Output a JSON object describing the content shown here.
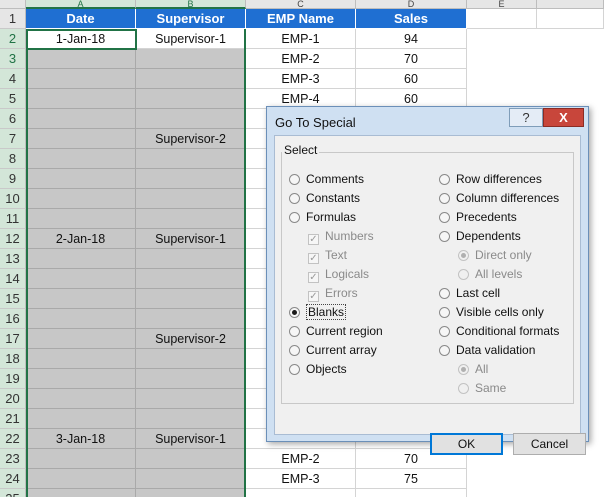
{
  "sheet": {
    "columns": [
      "A",
      "B",
      "C",
      "D",
      "E"
    ],
    "headers": [
      "Date",
      "Supervisor",
      "EMP Name",
      "Sales"
    ],
    "rows": [
      {
        "n": "2",
        "date": "1-Jan-18",
        "sup": "Supervisor-1",
        "emp": "EMP-1",
        "sales": "94"
      },
      {
        "n": "3",
        "date": "",
        "sup": "",
        "emp": "EMP-2",
        "sales": "70"
      },
      {
        "n": "4",
        "date": "",
        "sup": "",
        "emp": "EMP-3",
        "sales": "60"
      },
      {
        "n": "5",
        "date": "",
        "sup": "",
        "emp": "EMP-4",
        "sales": "60"
      },
      {
        "n": "6",
        "date": "",
        "sup": "",
        "emp": "",
        "sales": ""
      },
      {
        "n": "7",
        "date": "",
        "sup": "Supervisor-2",
        "emp": "",
        "sales": ""
      },
      {
        "n": "8",
        "date": "",
        "sup": "",
        "emp": "",
        "sales": ""
      },
      {
        "n": "9",
        "date": "",
        "sup": "",
        "emp": "",
        "sales": ""
      },
      {
        "n": "10",
        "date": "",
        "sup": "",
        "emp": "",
        "sales": ""
      },
      {
        "n": "11",
        "date": "",
        "sup": "",
        "emp": "",
        "sales": ""
      },
      {
        "n": "12",
        "date": "2-Jan-18",
        "sup": "Supervisor-1",
        "emp": "",
        "sales": ""
      },
      {
        "n": "13",
        "date": "",
        "sup": "",
        "emp": "",
        "sales": ""
      },
      {
        "n": "14",
        "date": "",
        "sup": "",
        "emp": "",
        "sales": ""
      },
      {
        "n": "15",
        "date": "",
        "sup": "",
        "emp": "",
        "sales": ""
      },
      {
        "n": "16",
        "date": "",
        "sup": "",
        "emp": "",
        "sales": ""
      },
      {
        "n": "17",
        "date": "",
        "sup": "Supervisor-2",
        "emp": "",
        "sales": ""
      },
      {
        "n": "18",
        "date": "",
        "sup": "",
        "emp": "",
        "sales": ""
      },
      {
        "n": "19",
        "date": "",
        "sup": "",
        "emp": "",
        "sales": ""
      },
      {
        "n": "20",
        "date": "",
        "sup": "",
        "emp": "",
        "sales": ""
      },
      {
        "n": "21",
        "date": "",
        "sup": "",
        "emp": "",
        "sales": ""
      },
      {
        "n": "22",
        "date": "3-Jan-18",
        "sup": "Supervisor-1",
        "emp": "",
        "sales": ""
      },
      {
        "n": "23",
        "date": "",
        "sup": "",
        "emp": "EMP-2",
        "sales": "70"
      },
      {
        "n": "24",
        "date": "",
        "sup": "",
        "emp": "EMP-3",
        "sales": "75"
      },
      {
        "n": "25",
        "date": "",
        "sup": "",
        "emp": "",
        "sales": ""
      }
    ]
  },
  "dialog": {
    "title": "Go To Special",
    "help": "?",
    "close": "X",
    "group_label": "Select",
    "left_options": [
      {
        "label": "Comments",
        "type": "radio",
        "checked": false,
        "disabled": false
      },
      {
        "label": "Constants",
        "type": "radio",
        "checked": false,
        "disabled": false
      },
      {
        "label": "Formulas",
        "type": "radio",
        "checked": false,
        "disabled": false
      },
      {
        "label": "Numbers",
        "type": "check",
        "checked": true,
        "disabled": true
      },
      {
        "label": "Text",
        "type": "check",
        "checked": true,
        "disabled": true
      },
      {
        "label": "Logicals",
        "type": "check",
        "checked": true,
        "disabled": true
      },
      {
        "label": "Errors",
        "type": "check",
        "checked": true,
        "disabled": true
      },
      {
        "label": "Blanks",
        "type": "radio",
        "checked": true,
        "disabled": false
      },
      {
        "label": "Current region",
        "type": "radio",
        "checked": false,
        "disabled": false
      },
      {
        "label": "Current array",
        "type": "radio",
        "checked": false,
        "disabled": false
      },
      {
        "label": "Objects",
        "type": "radio",
        "checked": false,
        "disabled": false
      }
    ],
    "right_options": [
      {
        "label": "Row differences",
        "type": "radio",
        "checked": false,
        "disabled": false
      },
      {
        "label": "Column differences",
        "type": "radio",
        "checked": false,
        "disabled": false
      },
      {
        "label": "Precedents",
        "type": "radio",
        "checked": false,
        "disabled": false
      },
      {
        "label": "Dependents",
        "type": "radio",
        "checked": false,
        "disabled": false
      },
      {
        "label": "Direct only",
        "type": "radio",
        "checked": true,
        "disabled": true
      },
      {
        "label": "All levels",
        "type": "radio",
        "checked": false,
        "disabled": true
      },
      {
        "label": "Last cell",
        "type": "radio",
        "checked": false,
        "disabled": false
      },
      {
        "label": "Visible cells only",
        "type": "radio",
        "checked": false,
        "disabled": false
      },
      {
        "label": "Conditional formats",
        "type": "radio",
        "checked": false,
        "disabled": false
      },
      {
        "label": "Data validation",
        "type": "radio",
        "checked": false,
        "disabled": false
      },
      {
        "label": "All",
        "type": "radio",
        "checked": true,
        "disabled": true
      },
      {
        "label": "Same",
        "type": "radio",
        "checked": false,
        "disabled": true
      }
    ],
    "ok_label": "OK",
    "cancel_label": "Cancel"
  }
}
